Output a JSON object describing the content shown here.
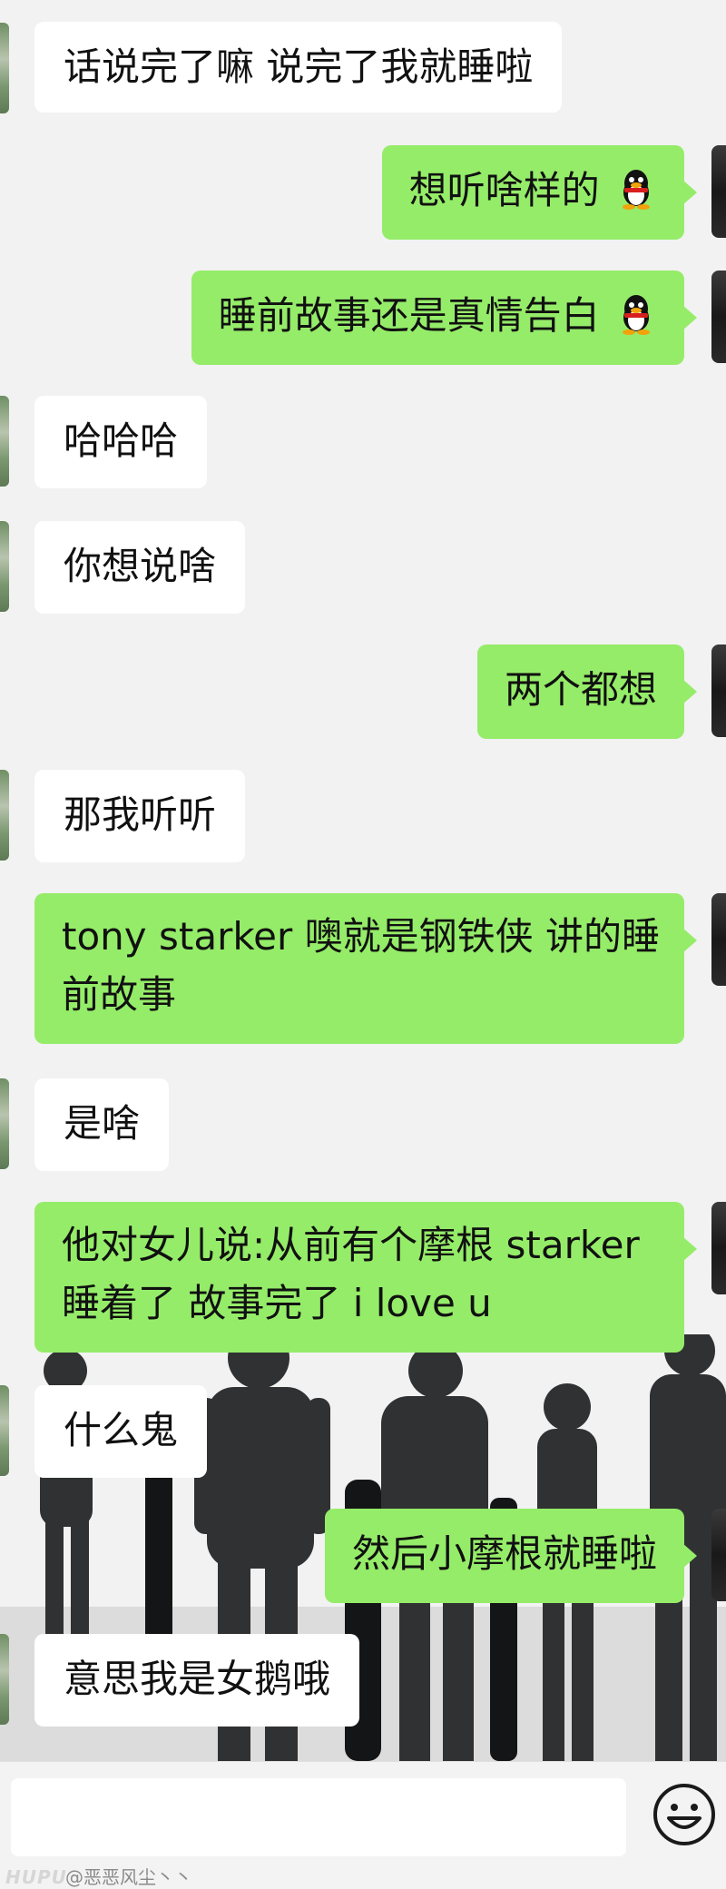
{
  "messages": [
    {
      "side": "in",
      "text": "话说完了嘛  说完了我就睡啦"
    },
    {
      "side": "out",
      "text": "想听啥样的",
      "emoji": "qq-penguin-emoji"
    },
    {
      "side": "out",
      "text": "睡前故事还是真情告白",
      "emoji": "qq-penguin-emoji"
    },
    {
      "side": "in",
      "text": "哈哈哈"
    },
    {
      "side": "in",
      "text": "你想说啥"
    },
    {
      "side": "out",
      "text": "两个都想"
    },
    {
      "side": "in",
      "text": "那我听听"
    },
    {
      "side": "out",
      "lines": [
        "tony starker 噢就是钢铁侠 讲的睡",
        "前故事"
      ]
    },
    {
      "side": "in",
      "text": "是啥"
    },
    {
      "side": "out",
      "lines": [
        "他对女儿说:从前有个摩根 starker",
        "睡着了 故事完了 i love u"
      ]
    },
    {
      "side": "in",
      "text": "什么鬼"
    },
    {
      "side": "out",
      "text": "然后小摩根就睡啦"
    },
    {
      "side": "in",
      "text": "意思我是女鹅哦"
    }
  ],
  "input": {
    "placeholder": "",
    "emoji_icon": "smiley-face-icon"
  },
  "footer": {
    "watermark": "HUPU",
    "username": "@恶恶风尘丶丶"
  },
  "colors": {
    "outgoing_bubble": "#95ec69",
    "incoming_bubble": "#ffffff",
    "background": "#f2f2f2"
  }
}
